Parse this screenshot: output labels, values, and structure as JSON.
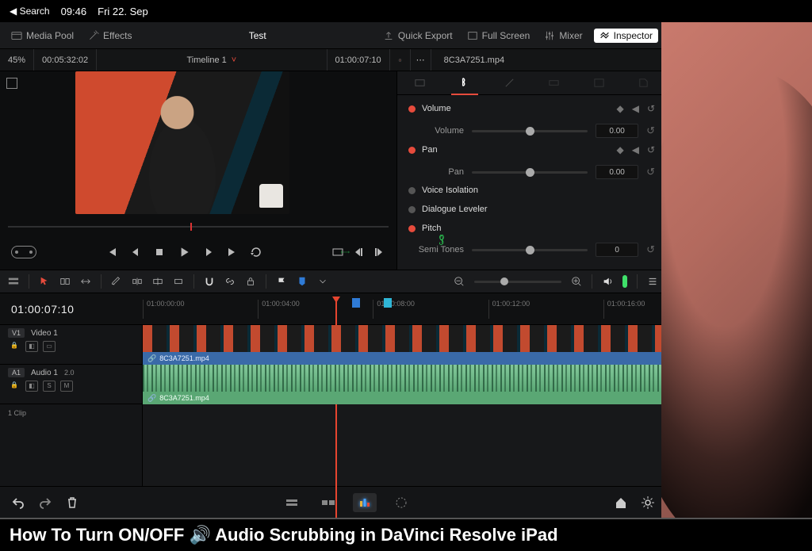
{
  "statusbar": {
    "back_label": "Search",
    "time": "09:46",
    "date": "Fri 22. Sep"
  },
  "topbar": {
    "media_pool": "Media Pool",
    "effects": "Effects",
    "project": "Test",
    "quick_export": "Quick Export",
    "full_screen": "Full Screen",
    "mixer": "Mixer",
    "inspector": "Inspector"
  },
  "row2": {
    "zoom_pct": "45%",
    "source_tc": "00:05:32:02",
    "timeline_name": "Timeline 1",
    "record_tc": "01:00:07:10",
    "clip_name": "8C3A7251.mp4"
  },
  "inspector": {
    "volume": {
      "title": "Volume",
      "label": "Volume",
      "value": "0.00"
    },
    "pan": {
      "title": "Pan",
      "label": "Pan",
      "value": "0.00"
    },
    "voice_isolation": "Voice Isolation",
    "dialogue_leveler": "Dialogue Leveler",
    "pitch": {
      "title": "Pitch",
      "label": "Semi Tones",
      "value": "0"
    }
  },
  "timeline": {
    "current_tc": "01:00:07:10",
    "ticks": [
      "01:00:00:00",
      "01:00:04:00",
      "01:00:08:00",
      "01:00:12:00",
      "01:00:16:00"
    ],
    "video_track": {
      "tag": "V1",
      "name": "Video 1",
      "clip": "8C3A7251.mp4"
    },
    "audio_track": {
      "tag": "A1",
      "name": "Audio 1",
      "height": "2.0",
      "clip": "8C3A7251.mp4",
      "solo": "S",
      "mute": "M"
    },
    "clip_count": "1 Clip"
  },
  "caption": "How To Turn ON/OFF 🔊 Audio Scrubbing in DaVinci Resolve iPad"
}
